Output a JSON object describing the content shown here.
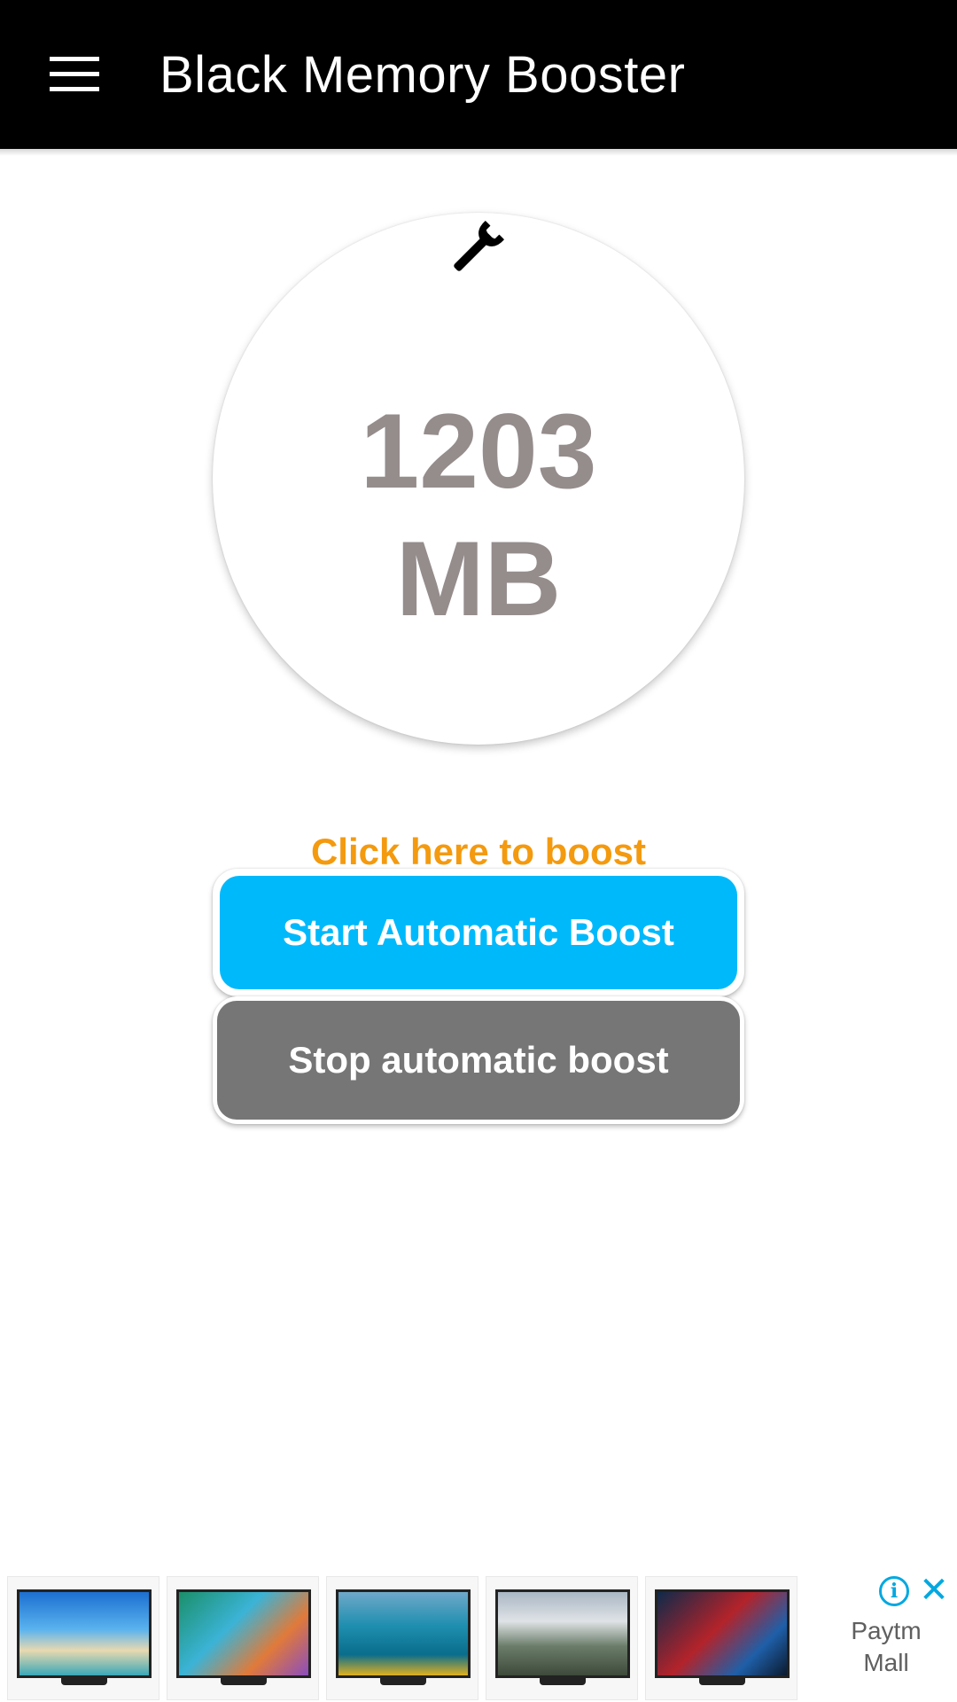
{
  "app": {
    "title": "Black Memory Booster"
  },
  "memory": {
    "value": "1203",
    "unit": "MB"
  },
  "actions": {
    "boost_link": "Click here to boost",
    "start_label": "Start Automatic Boost",
    "stop_label": "Stop automatic boost"
  },
  "ad": {
    "brand_line1": "Paytm",
    "brand_line2": "Mall",
    "info_icon": "info-icon",
    "close_icon": "close-icon",
    "thumbnails": [
      "tv-beach",
      "tv-menu-screen",
      "tv-kayak",
      "tv-mountains",
      "tv-sports"
    ]
  },
  "colors": {
    "appbar": "#000000",
    "meter_text": "#958c8c",
    "boost_link": "#f49a0f",
    "start_button": "#00b9fb",
    "stop_button": "#767676",
    "ad_accent": "#00a8e0"
  }
}
